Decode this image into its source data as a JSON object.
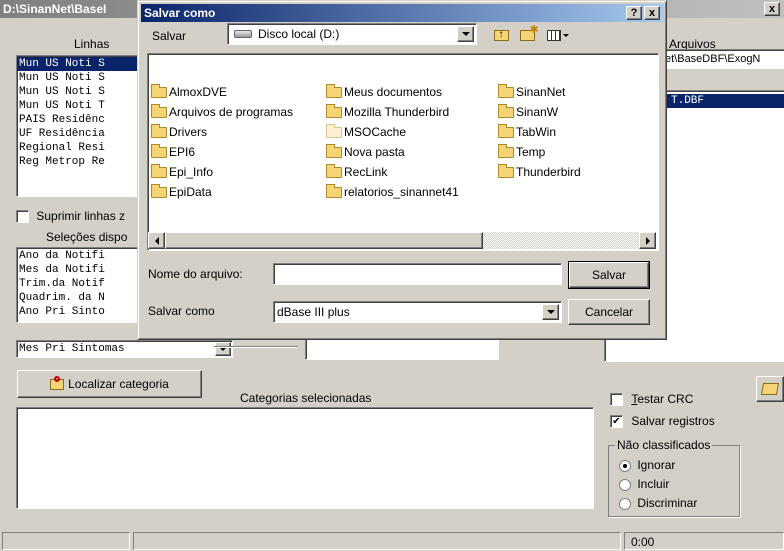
{
  "main": {
    "title": "D:\\SinanNet\\BaseI",
    "close_glyph": "x",
    "linhas_label": "Linhas",
    "arquivos_label": "Arquivos",
    "arquivos_path": "et\\BaseDBF\\ExogN",
    "arquivo_selected": "T.DBF",
    "linhas_items": [
      "Mun US Noti S",
      "Mun US Noti S",
      "Mun US Noti S",
      "Mun US Noti T",
      "PAIS Residênc",
      "UF Residência",
      "Regional Resi",
      "Reg Metrop Re"
    ],
    "suprimir_label": "Suprimir linhas z",
    "selecoes_label": "Seleções dispo",
    "selecoes_items": [
      "Ano da Notifi",
      "Mes da Notifi",
      "Trim.da Notif",
      "Quadrim. da N",
      "Ano Pri Sinto"
    ],
    "selecoes_combo_value": "Mes Pri Sintomas",
    "localizar_button": "Localizar categoria",
    "categorias_label": "Categorias selecionadas",
    "testar_crc": "Testar CRC",
    "salvar_registros": "Salvar registros",
    "nao_classificados": "Não classificados",
    "radio_ignorar": "Ignorar",
    "radio_incluir": "Incluir",
    "radio_discriminar": "Discriminar",
    "status_time": "0:00"
  },
  "dialog": {
    "title": "Salvar como",
    "help_glyph": "?",
    "close_glyph": "x",
    "salvar_em_label": "Salvar",
    "location_value": "Disco local (D:)",
    "files": [
      {
        "name": "AlmoxDVE"
      },
      {
        "name": "Arquivos de programas"
      },
      {
        "name": "Drivers"
      },
      {
        "name": "EPI6"
      },
      {
        "name": "Epi_Info"
      },
      {
        "name": "EpiData"
      },
      {
        "name": "Meus documentos"
      },
      {
        "name": "Mozilla Thunderbird"
      },
      {
        "name": "MSOCache"
      },
      {
        "name": "Nova pasta"
      },
      {
        "name": "RecLink"
      },
      {
        "name": "relatorios_sinannet41"
      },
      {
        "name": "SinanNet"
      },
      {
        "name": "SinanW"
      },
      {
        "name": "TabWin"
      },
      {
        "name": "Temp"
      },
      {
        "name": "Thunderbird"
      }
    ],
    "filename_label": "Nome do arquivo:",
    "filename_value": "",
    "salvar_button": "Salvar",
    "type_label": "Salvar como",
    "type_value": "dBase III plus",
    "cancelar_button": "Cancelar"
  }
}
